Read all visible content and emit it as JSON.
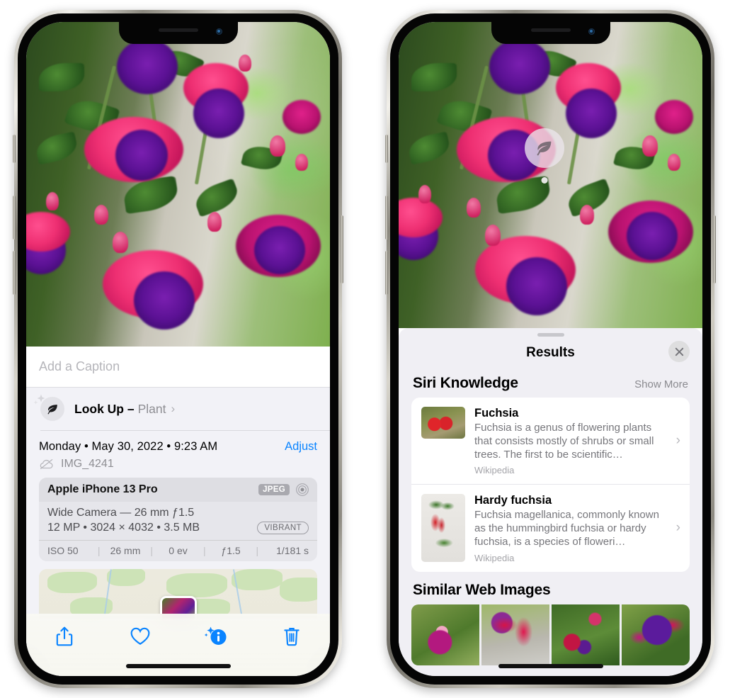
{
  "left_phone": {
    "caption": {
      "placeholder": "Add a Caption",
      "value": ""
    },
    "lookup": {
      "label": "Look Up –",
      "subject": "Plant",
      "chevron": "›",
      "icon": "leaf-icon",
      "sparkle_icon": "sparkle-icon"
    },
    "details": {
      "date_line": "Monday • May 30, 2022 • 9:23 AM",
      "adjust_label": "Adjust",
      "filename": "IMG_4241",
      "cloud_icon": "cloud-slash-icon"
    },
    "camera_card": {
      "device": "Apple iPhone 13 Pro",
      "format_badge": "JPEG",
      "aperture_icon": "aperture-icon",
      "lens_line": "Wide Camera — 26 mm ƒ1.5",
      "size_line": "12 MP • 3024 × 4032 • 3.5 MB",
      "style_badge": "VIBRANT",
      "exif": [
        "ISO 50",
        "26 mm",
        "0 ev",
        "ƒ1.5",
        "1/181 s"
      ]
    },
    "map": {
      "pin": "photo-thumbnail-pin"
    },
    "toolbar": [
      {
        "name": "share-button",
        "icon": "share-icon"
      },
      {
        "name": "favorite-button",
        "icon": "heart-icon"
      },
      {
        "name": "info-button",
        "icon": "info-sparkle-icon"
      },
      {
        "name": "delete-button",
        "icon": "trash-icon"
      }
    ],
    "accent_color": "#0a84ff"
  },
  "right_phone": {
    "leaf_badge": {
      "icon": "leaf-icon"
    },
    "results": {
      "grabber": "sheet-grabber",
      "title": "Results",
      "close_icon": "close-icon"
    },
    "siri_knowledge": {
      "title": "Siri Knowledge",
      "show_more": "Show More",
      "items": [
        {
          "title": "Fuchsia",
          "description": "Fuchsia is a genus of flowering plants that consists mostly of shrubs or small trees. The first to be scientific…",
          "source": "Wikipedia",
          "chevron": "›"
        },
        {
          "title": "Hardy fuchsia",
          "description": "Fuchsia magellanica, commonly known as the hummingbird fuchsia or hardy fuchsia, is a species of floweri…",
          "source": "Wikipedia",
          "chevron": "›"
        }
      ]
    },
    "similar_web_images": {
      "title": "Similar Web Images",
      "thumbnails": [
        "web-image-1",
        "web-image-2",
        "web-image-3",
        "web-image-4"
      ]
    }
  }
}
